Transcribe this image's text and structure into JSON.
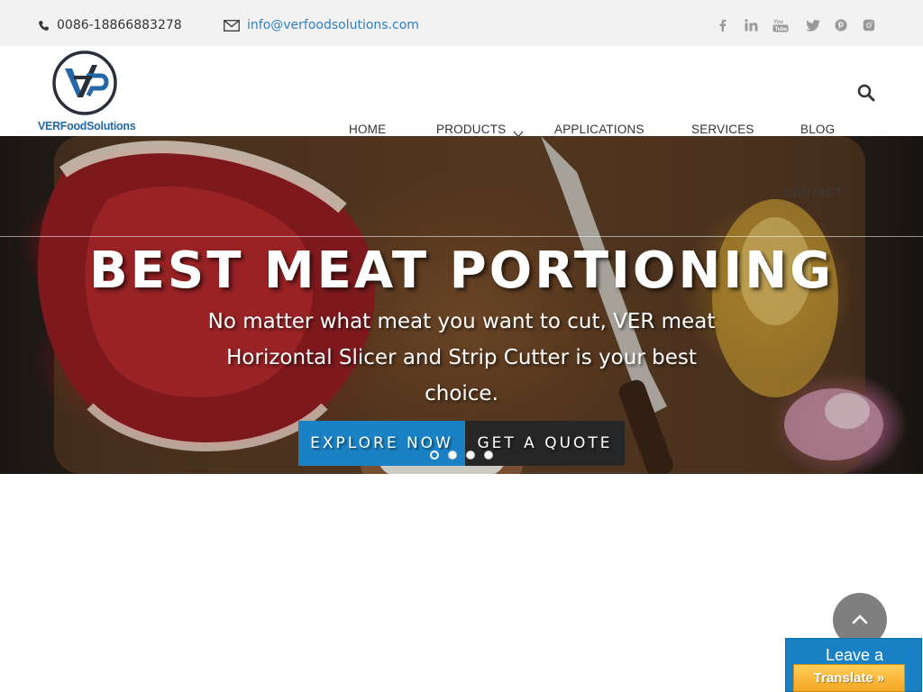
{
  "topbar": {
    "phone": "0086-18866883278",
    "email": "info@verfoodsolutions.com",
    "social": [
      "facebook-icon",
      "linkedin-icon",
      "youtube-icon",
      "twitter-icon",
      "pinterest-icon",
      "instagram-icon"
    ]
  },
  "header": {
    "logo_text": "VERFoodSolutions",
    "nav": {
      "home": "HOME",
      "products": "PRODUCTS",
      "applications": "APPLICATIONS",
      "services": "SERVICES",
      "blog": "BLOG",
      "contact": "CONTACT"
    }
  },
  "hero": {
    "title": "BEST MEAT PORTIONING",
    "subtitle": "No matter what meat you want to cut, VER meat Horizontal Slicer and Strip Cutter is your best choice.",
    "explore_label": "EXPLORE NOW",
    "quote_label": "GET A QUOTE",
    "slide_count": 4,
    "active_slide": 1
  },
  "widgets": {
    "leave_message": "Leave a",
    "translate": "Translate »"
  },
  "colors": {
    "accent": "#1a82c4",
    "topbar_bg": "#f2f2f2",
    "link": "#2f7fc5"
  }
}
